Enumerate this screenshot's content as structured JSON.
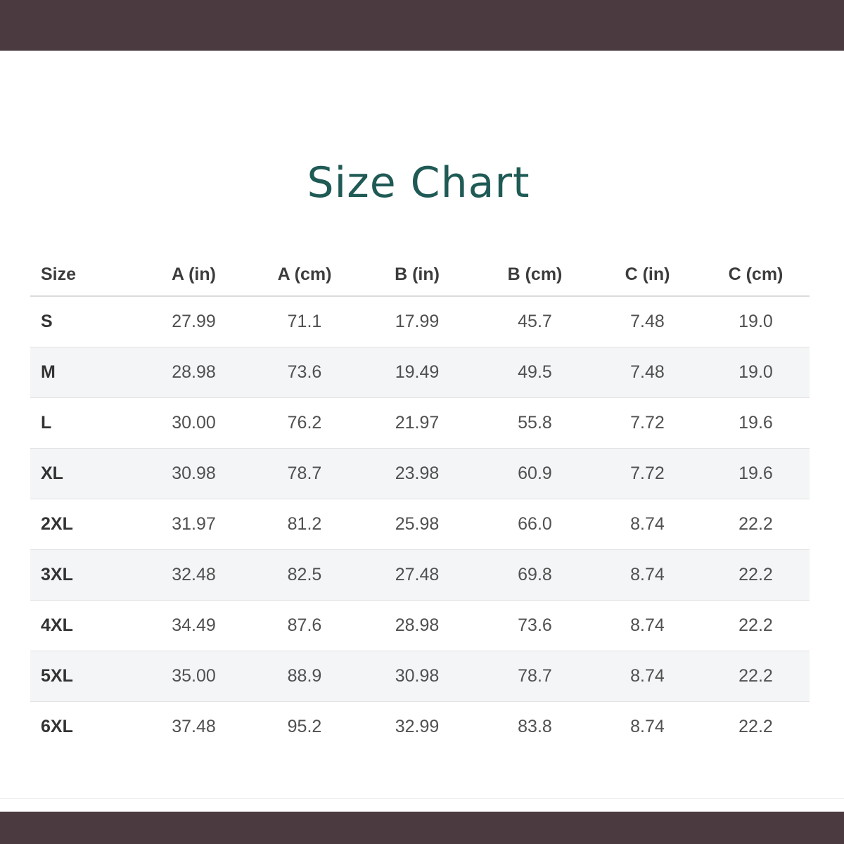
{
  "title": "Size Chart",
  "colors": {
    "band": "#4b3a40",
    "title": "#1f5a55",
    "stripe": "#f4f5f7"
  },
  "table": {
    "headers": [
      "Size",
      "A (in)",
      "A (cm)",
      "B (in)",
      "B (cm)",
      "C (in)",
      "C (cm)"
    ],
    "rows": [
      [
        "S",
        "27.99",
        "71.1",
        "17.99",
        "45.7",
        "7.48",
        "19.0"
      ],
      [
        "M",
        "28.98",
        "73.6",
        "19.49",
        "49.5",
        "7.48",
        "19.0"
      ],
      [
        "L",
        "30.00",
        "76.2",
        "21.97",
        "55.8",
        "7.72",
        "19.6"
      ],
      [
        "XL",
        "30.98",
        "78.7",
        "23.98",
        "60.9",
        "7.72",
        "19.6"
      ],
      [
        "2XL",
        "31.97",
        "81.2",
        "25.98",
        "66.0",
        "8.74",
        "22.2"
      ],
      [
        "3XL",
        "32.48",
        "82.5",
        "27.48",
        "69.8",
        "8.74",
        "22.2"
      ],
      [
        "4XL",
        "34.49",
        "87.6",
        "28.98",
        "73.6",
        "8.74",
        "22.2"
      ],
      [
        "5XL",
        "35.00",
        "88.9",
        "30.98",
        "78.7",
        "8.74",
        "22.2"
      ],
      [
        "6XL",
        "37.48",
        "95.2",
        "32.99",
        "83.8",
        "8.74",
        "22.2"
      ]
    ]
  }
}
